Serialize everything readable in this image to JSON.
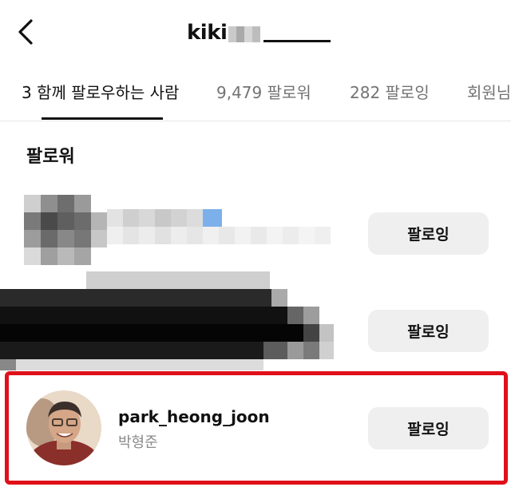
{
  "header": {
    "title": "kiki",
    "back_icon": "chevron-left-icon"
  },
  "tabs": [
    {
      "label": "3 함께 팔로우하는 사람",
      "active": true
    },
    {
      "label": "9,479 팔로워",
      "active": false
    },
    {
      "label": "282 팔로잉",
      "active": false
    },
    {
      "label": "회원님",
      "active": false
    }
  ],
  "section": {
    "title": "팔로워"
  },
  "rows": [
    {
      "username": "",
      "name": "",
      "button_label": "팔로잉",
      "censored": true
    },
    {
      "username": "",
      "name": "",
      "button_label": "팔로잉",
      "censored": true
    },
    {
      "username": "park_heong_joon",
      "name": "박형준",
      "button_label": "팔로잉",
      "highlighted": true
    }
  ],
  "colors": {
    "highlight_border": "#e0101a",
    "button_bg": "#efefef",
    "secondary_text": "#737373"
  }
}
